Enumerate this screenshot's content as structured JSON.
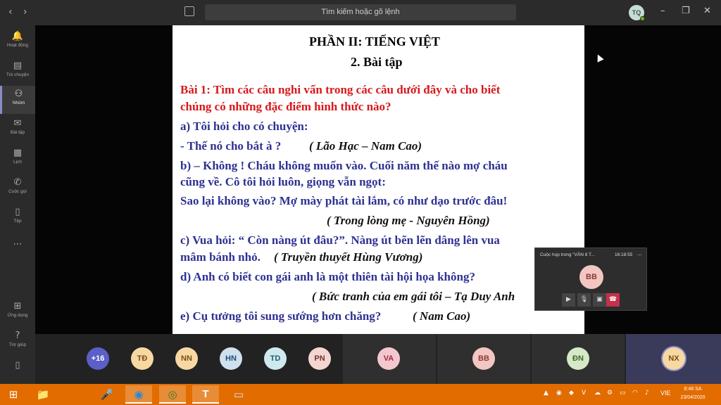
{
  "titlebar": {
    "back_icon": "chevron-left",
    "forward_icon": "chevron-right",
    "search_placeholder": "Tìm kiếm hoặc gõ lệnh",
    "user_initials": "TQ",
    "minimize": "–",
    "maximize": "❐",
    "close": "✕"
  },
  "rail": [
    {
      "label": "Hoạt động",
      "icon": "bell-icon",
      "glyph": "🔔"
    },
    {
      "label": "Trò chuyện",
      "icon": "chat-icon",
      "glyph": "▤"
    },
    {
      "label": "Nhóm",
      "icon": "teams-icon",
      "glyph": "⚇",
      "active": true
    },
    {
      "label": "Bài tập",
      "icon": "assignments-icon",
      "glyph": "✉"
    },
    {
      "label": "Lịch",
      "icon": "calendar-icon",
      "glyph": "▦"
    },
    {
      "label": "Cuộc gọi",
      "icon": "phone-icon",
      "glyph": "✆"
    },
    {
      "label": "Tệp",
      "icon": "files-icon",
      "glyph": "▯"
    },
    {
      "label": "",
      "icon": "more-icon",
      "glyph": "⋯"
    }
  ],
  "rail_bottom": [
    {
      "label": "Ứng dụng",
      "icon": "apps-icon",
      "glyph": "⊞"
    },
    {
      "label": "Trợ giúp",
      "icon": "help-icon",
      "glyph": "?"
    },
    {
      "label": "",
      "icon": "device-icon",
      "glyph": "▯"
    }
  ],
  "slide": {
    "heading": "PHẦN II: TIẾNG VIỆT",
    "subheading": "2. Bài tập",
    "exercise_line1": "Bài 1: Tìm các câu nghi vấn trong các câu dưới đây và cho biết",
    "exercise_line2": "chúng có những đặc điểm hình thức nào?",
    "a_line": "a)   Tôi hỏi cho có chuyện:",
    "a_quote": "-   Thế nó cho bắt à ?",
    "a_source": "( Lão Hạc – Nam Cao)",
    "b_line1": "b) – Không ! Cháu không muốn vào. Cuối năm thế nào mợ cháu",
    "b_line2": "cũng về. Cô tôi hỏi luôn, giọng vẫn ngọt:",
    "b_line3": "Sao lại không vào? Mợ mày phát tài lắm, có như dạo trước đâu!",
    "b_source": "( Trong lòng mẹ - Nguyên Hồng)",
    "c_line1": "c) Vua hỏi: “ Còn nàng út đâu?”. Nàng út bẽn lẽn dâng lên vua",
    "c_line2": "mâm bánh nhỏ.",
    "c_source": "( Truyền thuyết Hùng Vương)",
    "d_line": "d) Anh có biết con gái anh là một thiên tài hội họa không?",
    "d_source": "( Bức tranh của em gái tôi – Tạ Duy Anh",
    "e_line": "e) Cụ tưởng tôi sung sướng hơn chăng?",
    "e_source": "( Nam Cao)"
  },
  "pip": {
    "title": "Cuộc họp trong \"VĂN 8 T...",
    "time": "16:18:55",
    "more": "...",
    "avatar": "BB",
    "controls": [
      {
        "name": "camera-icon",
        "glyph": "▶"
      },
      {
        "name": "mic-icon",
        "glyph": "🎙"
      },
      {
        "name": "share-screen-icon",
        "glyph": "▣"
      },
      {
        "name": "hang-up-icon",
        "glyph": "☎"
      }
    ]
  },
  "participants": [
    {
      "initials": "+16",
      "bg": "#5b5fc7",
      "fg": "#ffffff"
    },
    {
      "initials": "TĐ",
      "bg": "#f7d8a3",
      "fg": "#7a4f0f"
    },
    {
      "initials": "NN",
      "bg": "#f7d8a3",
      "fg": "#7a4f0f"
    },
    {
      "initials": "HN",
      "bg": "#cfe0ee",
      "fg": "#1f4e79"
    },
    {
      "initials": "TD",
      "bg": "#cfe9ef",
      "fg": "#1f5f6e"
    },
    {
      "initials": "PN",
      "bg": "#f3d6d2",
      "fg": "#7a2f2a"
    },
    {
      "initials": "VA",
      "bg": "#f4c7cf",
      "fg": "#9c2a45"
    },
    {
      "initials": "BB",
      "bg": "#f3c6c2",
      "fg": "#8a3b34"
    },
    {
      "initials": "ĐN",
      "bg": "#d6e8c8",
      "fg": "#3e6b23"
    },
    {
      "initials": "NX",
      "bg": "#f7d8a3",
      "fg": "#7a4f0f"
    }
  ],
  "taskbar": {
    "apps": [
      {
        "name": "start-icon",
        "glyph": "⊞"
      },
      {
        "name": "file-explorer-icon",
        "glyph": "📁"
      },
      {
        "name": "recorder-icon",
        "glyph": "🎤"
      },
      {
        "name": "browser-icon",
        "glyph": "◉"
      },
      {
        "name": "chrome-icon",
        "glyph": "◎"
      },
      {
        "name": "teams-app-icon",
        "glyph": "T"
      },
      {
        "name": "photos-icon",
        "glyph": "▭"
      }
    ],
    "language": "VIE",
    "time": "8:48 SA",
    "date": "23/04/2020"
  },
  "colors": {
    "slide_text": "#2e3192",
    "slide_red": "#d7191c",
    "taskbar": "#e26c00",
    "rail_accent": "#8b8cc7"
  }
}
